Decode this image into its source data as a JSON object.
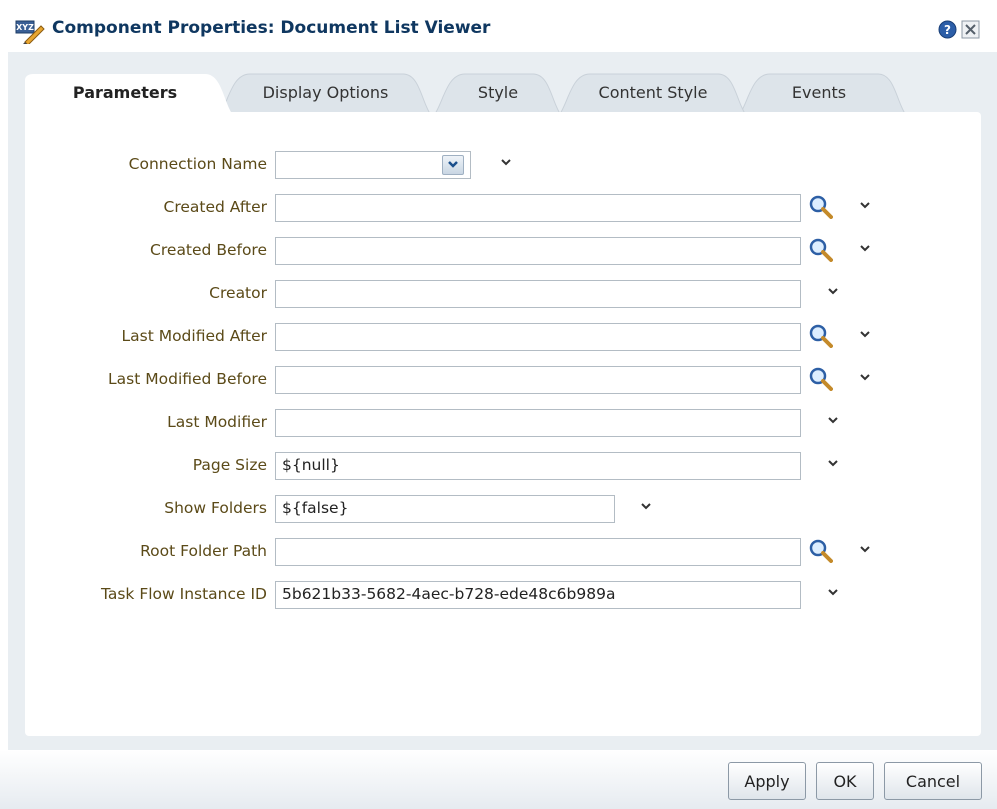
{
  "dialog": {
    "title": "Component Properties: Document List Viewer",
    "title_icon": "properties-edit-icon",
    "help_icon": "help-icon",
    "close_icon": "close-icon"
  },
  "tabs": [
    {
      "label": "Parameters",
      "active": true
    },
    {
      "label": "Display Options",
      "active": false
    },
    {
      "label": "Style",
      "active": false
    },
    {
      "label": "Content Style",
      "active": false
    },
    {
      "label": "Events",
      "active": false
    }
  ],
  "parameters": [
    {
      "label": "Connection Name",
      "value": "",
      "control": "select"
    },
    {
      "label": "Created After",
      "value": "",
      "control": "text-search"
    },
    {
      "label": "Created Before",
      "value": "",
      "control": "text-search"
    },
    {
      "label": "Creator",
      "value": "",
      "control": "text"
    },
    {
      "label": "Last Modified After",
      "value": "",
      "control": "text-search"
    },
    {
      "label": "Last Modified Before",
      "value": "",
      "control": "text-search"
    },
    {
      "label": "Last Modifier",
      "value": "",
      "control": "text"
    },
    {
      "label": "Page Size",
      "value": "${null}",
      "control": "text"
    },
    {
      "label": "Show Folders",
      "value": "${false}",
      "control": "text-short"
    },
    {
      "label": "Root Folder Path",
      "value": "",
      "control": "text-search"
    },
    {
      "label": "Task Flow Instance ID",
      "value": "5b621b33-5682-4aec-b728-ede48c6b989a",
      "control": "text"
    }
  ],
  "footer": {
    "apply_label": "Apply",
    "ok_label": "OK",
    "cancel_label": "Cancel"
  },
  "colors": {
    "title": "#0f3760",
    "label": "#5b4a18",
    "body_bg": "#e9eef2",
    "field_border": "#b3bcc4"
  }
}
